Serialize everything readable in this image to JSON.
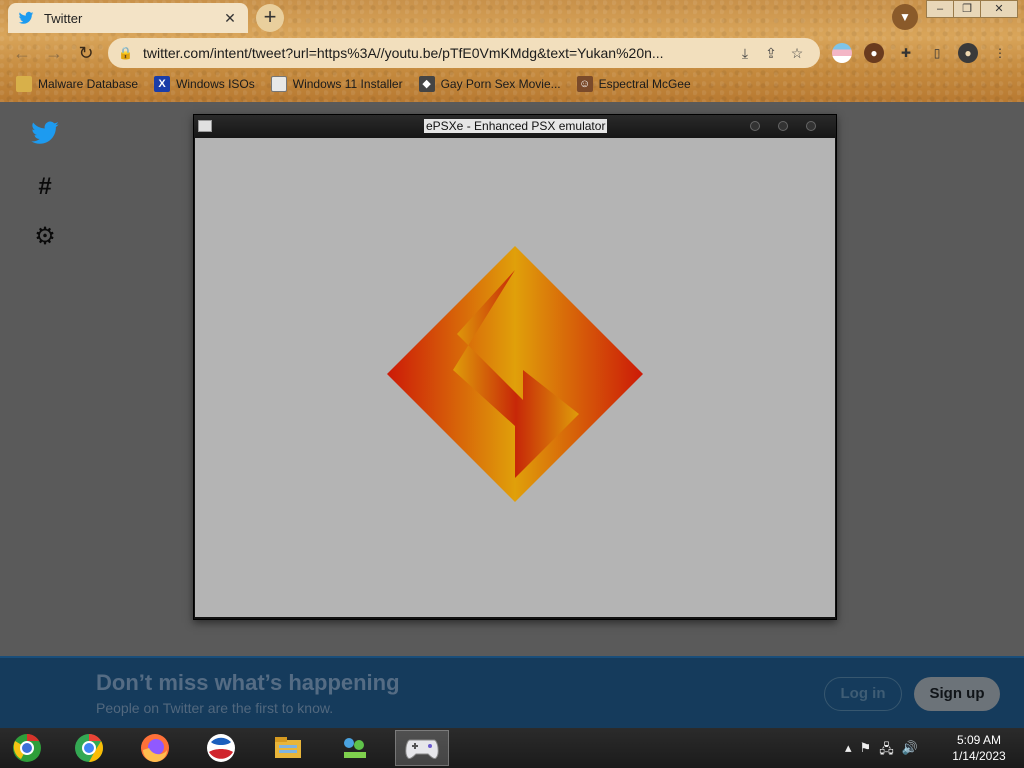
{
  "browser": {
    "tab_title": "Twitter",
    "tab_close": "✕",
    "new_tab": "+",
    "url": "twitter.com/intent/tweet?url=https%3A//youtu.be/pTfE0VmKMdg&text=Yukan%20n...",
    "window_controls": {
      "minimize": "–",
      "maximize": "❐",
      "close": "✕"
    },
    "nav": {
      "back": "←",
      "forward": "→",
      "reload": "↻"
    },
    "bookmarks": [
      {
        "label": "Malware Database",
        "icon": "folder-icon"
      },
      {
        "label": "Windows ISOs",
        "icon": "x-icon"
      },
      {
        "label": "Windows 11 Installer",
        "icon": "image-icon"
      },
      {
        "label": "Gay Porn Sex Movie...",
        "icon": "site-icon"
      },
      {
        "label": "Espectral McGee",
        "icon": "face-icon"
      }
    ]
  },
  "twitter_page": {
    "promo_title": "Don’t miss what’s happening",
    "promo_subtitle": "People on Twitter are the first to know.",
    "login_label": "Log in",
    "signup_label": "Sign up",
    "sidebar_icons": [
      "twitter-bird-icon",
      "hashtag-icon",
      "settings-gear-icon"
    ]
  },
  "emulator_window": {
    "title": "ePSXe - Enhanced PSX emulator",
    "screen_bg": "#b4b4b4"
  },
  "taskbar": {
    "apps": [
      "chrome-old-icon",
      "chrome-icon",
      "firefox-icon",
      "obama-logo-icon",
      "file-explorer-icon",
      "network-people-icon",
      "epsxe-gamepad-icon"
    ],
    "clock_time": "5:09 AM",
    "clock_date": "1/14/2023"
  },
  "colors": {
    "twitter_blue": "#1d9bf0",
    "promo_bg": "#153b5c",
    "logo_red": "#d42a0a",
    "logo_yellow": "#e8b40a"
  }
}
